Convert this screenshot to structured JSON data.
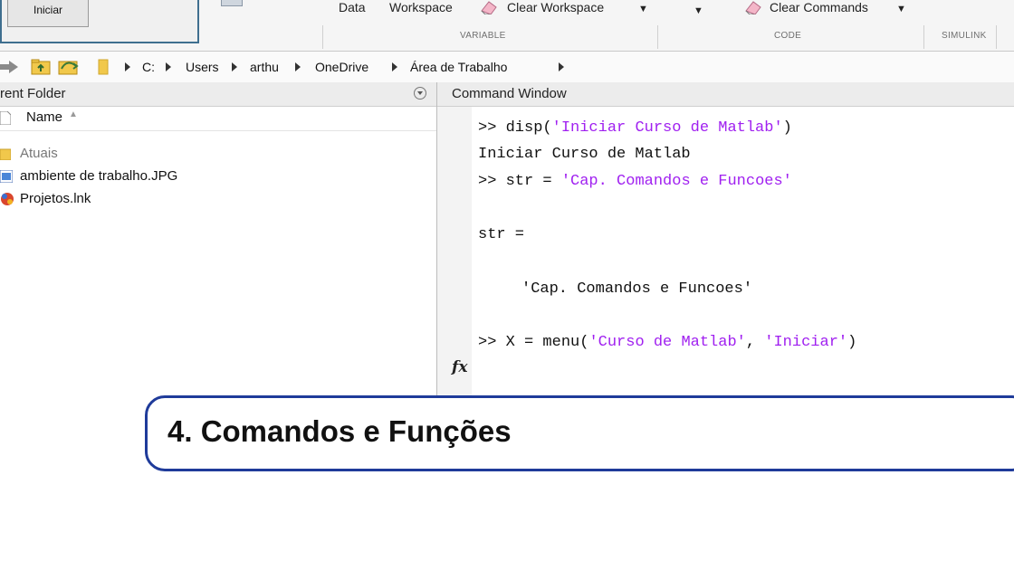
{
  "ribbon": {
    "menu_button": "Iniciar",
    "data_label": "Data",
    "workspace_label": "Workspace",
    "clear_workspace": "Clear Workspace",
    "clear_commands": "Clear Commands",
    "groups": [
      "VARIABLE",
      "CODE",
      "SIMULINK"
    ]
  },
  "address": {
    "path": [
      "C:",
      "Users",
      "arthu",
      "OneDrive",
      "Área de Trabalho"
    ]
  },
  "current_folder": {
    "title": "rent Folder",
    "column_name": "Name",
    "files": [
      "Atuais",
      "ambiente de trabalho.JPG",
      "Projetos.lnk"
    ]
  },
  "command_window": {
    "title": "Command Window",
    "prompt": ">>",
    "lines": {
      "l1_cmd": "disp(",
      "l1_str": "'Iniciar Curso de Matlab'",
      "l1_end": ")",
      "l2": "Iniciar Curso de Matlab",
      "l3_cmd": "str = ",
      "l3_str": "'Cap. Comandos e Funcoes'",
      "l4": "str =",
      "l5": "'Cap. Comandos e Funcoes'",
      "l6_cmd": "X = menu(",
      "l6_str1": "'Curso de Matlab'",
      "l6_sep": ", ",
      "l6_str2": "'Iniciar'",
      "l6_end": ")"
    },
    "fx_label": "fx"
  },
  "chapter": {
    "title": "4. Comandos e Funções"
  },
  "colors": {
    "string": "#a020f0",
    "chapter_border": "#1f3b9a"
  }
}
